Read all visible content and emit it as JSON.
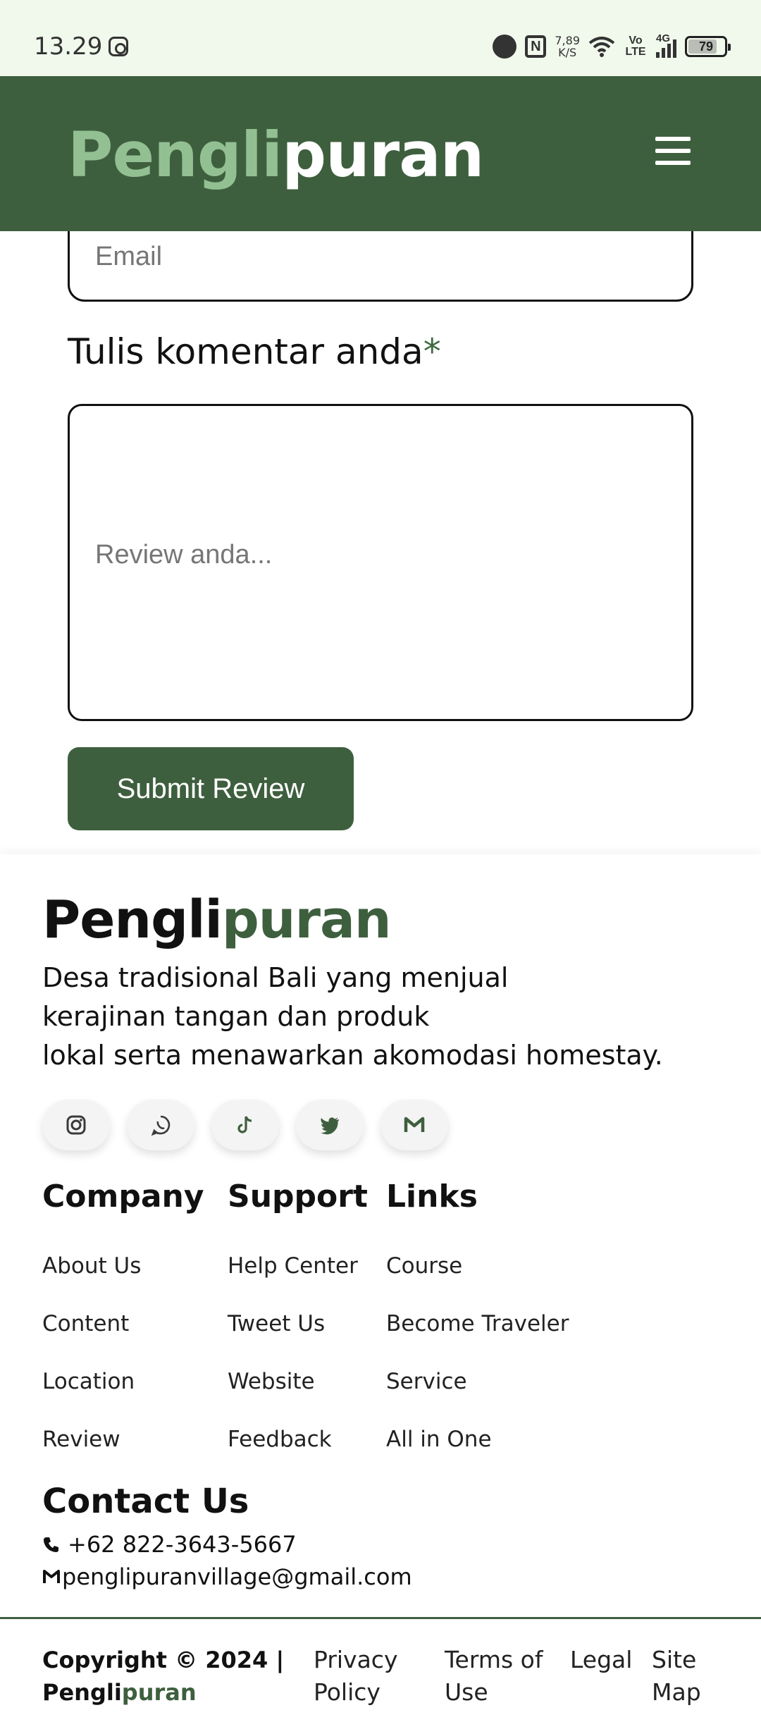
{
  "status_bar": {
    "time": "13.29",
    "speed_value": "7,89",
    "speed_unit": "K/S",
    "volte": "Vo LTE",
    "network": "4G",
    "battery": "79",
    "battery_level": 0.79,
    "icons": [
      "instagram-icon",
      "alarm-icon",
      "nfc-icon",
      "wifi-icon",
      "signal-icon",
      "battery-icon"
    ]
  },
  "header": {
    "brand_part1": "Pengli",
    "brand_part2": "puran",
    "menu_icon": "hamburger-menu-icon"
  },
  "form": {
    "email_placeholder": "Email",
    "comment_label": "Tulis komentar anda",
    "required_mark": "*",
    "review_placeholder": "Review anda...",
    "submit_label": "Submit Review"
  },
  "footer": {
    "brand_part1": "Pengli",
    "brand_part2": "puran",
    "description": [
      "Desa tradisional Bali yang menjual",
      "kerajinan tangan dan produk",
      "lokal serta menawarkan akomodasi homestay."
    ],
    "socials": [
      "instagram-icon",
      "whatsapp-icon",
      "tiktok-icon",
      "twitter-icon",
      "gmail-icon"
    ],
    "columns": [
      {
        "title": "Company",
        "links": [
          "About Us",
          "Content",
          "Location",
          "Review"
        ]
      },
      {
        "title": "Support",
        "links": [
          "Help Center",
          "Tweet Us",
          "Website",
          "Feedback"
        ]
      },
      {
        "title": "Links",
        "links": [
          "Course",
          "Become Traveler",
          "Service",
          "All in One"
        ]
      }
    ],
    "contact_title": "Contact Us",
    "phone": "+62 822-3643-5667",
    "email": "penglipuranvillage@gmail.com",
    "copyright_line1": "Copyright © 2024 |",
    "copyright_brand1": "Pengli",
    "copyright_brand2": "puran",
    "bottom_links": [
      "Privacy Policy",
      "Terms of Use",
      "Legal",
      "Site Map"
    ]
  },
  "colors": {
    "primary": "#3e5f3e",
    "brand_light": "#93c093",
    "status_bar_bg": "#f1f9ec"
  }
}
